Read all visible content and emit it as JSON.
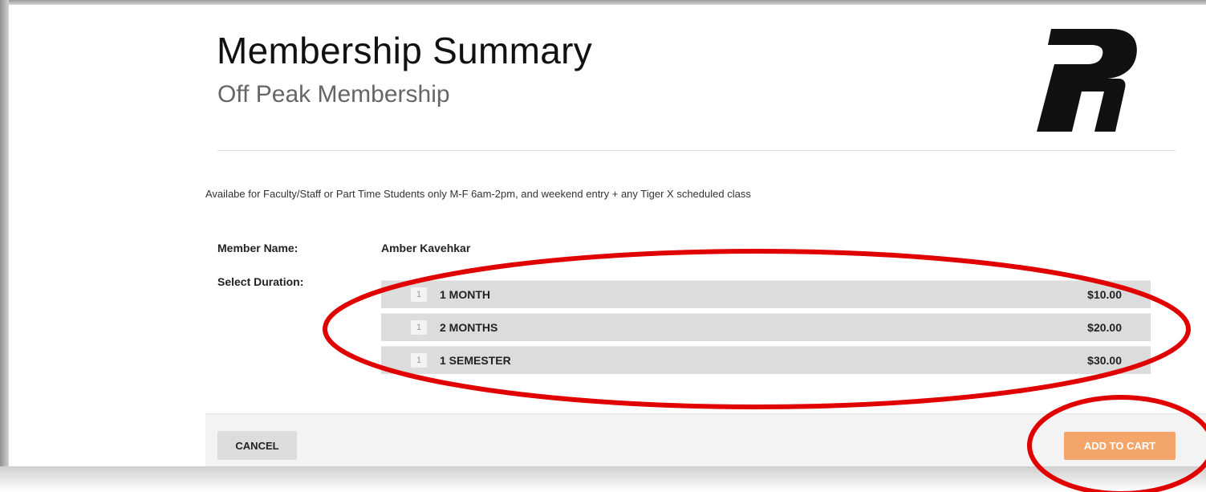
{
  "header": {
    "title": "Membership Summary",
    "subtitle": "Off Peak Membership"
  },
  "logo": {
    "icon": "pr-logo-icon"
  },
  "description": "Availabe for Faculty/Staff or Part Time Students only M-F 6am-2pm, and weekend entry + any Tiger X scheduled class",
  "member": {
    "label": "Member Name:",
    "value": "Amber Kavehkar"
  },
  "duration": {
    "label": "Select Duration:",
    "options": [
      {
        "qty": "1",
        "label": "1 MONTH",
        "price": "$10.00"
      },
      {
        "qty": "1",
        "label": "2 MONTHS",
        "price": "$20.00"
      },
      {
        "qty": "1",
        "label": "1 SEMESTER",
        "price": "$30.00"
      }
    ]
  },
  "footer": {
    "cancel_label": "CANCEL",
    "add_label": "ADD TO CART"
  },
  "colors": {
    "accent": "#f4a56a",
    "annotation": "#e00000",
    "option_bg": "#dcdcdc"
  }
}
